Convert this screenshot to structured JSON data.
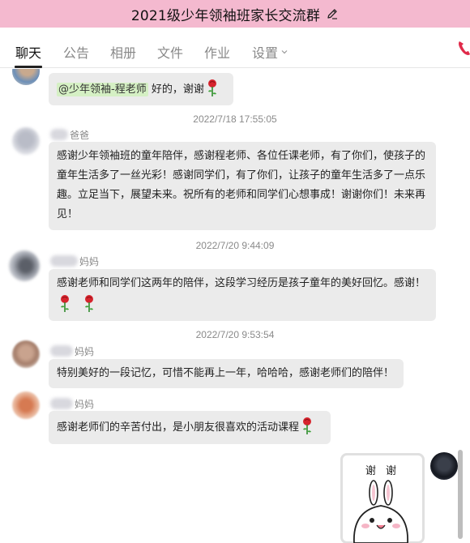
{
  "window": {
    "title": "2021级少年领袖班家长交流群"
  },
  "tabs": [
    {
      "label": "聊天",
      "active": true
    },
    {
      "label": "公告"
    },
    {
      "label": "相册"
    },
    {
      "label": "文件"
    },
    {
      "label": "作业"
    },
    {
      "label": "设置"
    }
  ],
  "icons": {
    "edit": "pencil-edit-icon",
    "settings_dropdown": "chevron-down-icon",
    "call": "phone-icon",
    "flower": "rose-icon"
  },
  "colors": {
    "title_bar": "#f4b9cf",
    "bubble": "#ebebeb",
    "mention_highlight": "#d5f0c4",
    "call_icon": "#e02a4a"
  },
  "messages": [
    {
      "mention": "@少年领袖-程老师",
      "text": " 好的，谢谢",
      "roses": 1
    },
    {
      "timestamp": "2022/7/18 17:55:05",
      "sender_suffix": "爸爸",
      "lines": [
        "感谢少年领袖班的童年陪伴，感谢程老师、各位任课老师，有了你们，使孩子的",
        "童年生活多了一丝光彩！感谢同学们，有了你们，让孩子的童年生活多了一点乐",
        "趣。立足当下，展望未来。祝所有的老师和同学们心想事成！谢谢你们！未来再",
        "见！"
      ]
    },
    {
      "timestamp": "2022/7/20 9:44:09",
      "sender_suffix": "妈妈",
      "lines": [
        "感谢老师和同学们这两年的陪伴，这段学习经历是孩子童年的美好回忆。感谢！"
      ],
      "roses": 2
    },
    {
      "timestamp": "2022/7/20 9:53:54",
      "sender_suffix": "妈妈",
      "lines": [
        "特别美好的一段记忆，可惜不能再上一年，哈哈哈，感谢老师们的陪伴！"
      ]
    },
    {
      "sender_suffix": "妈妈",
      "text": "感谢老师们的辛苦付出，是小朋友很喜欢的活动课程",
      "roses": 1
    },
    {
      "sticker_text": "谢 谢"
    }
  ]
}
